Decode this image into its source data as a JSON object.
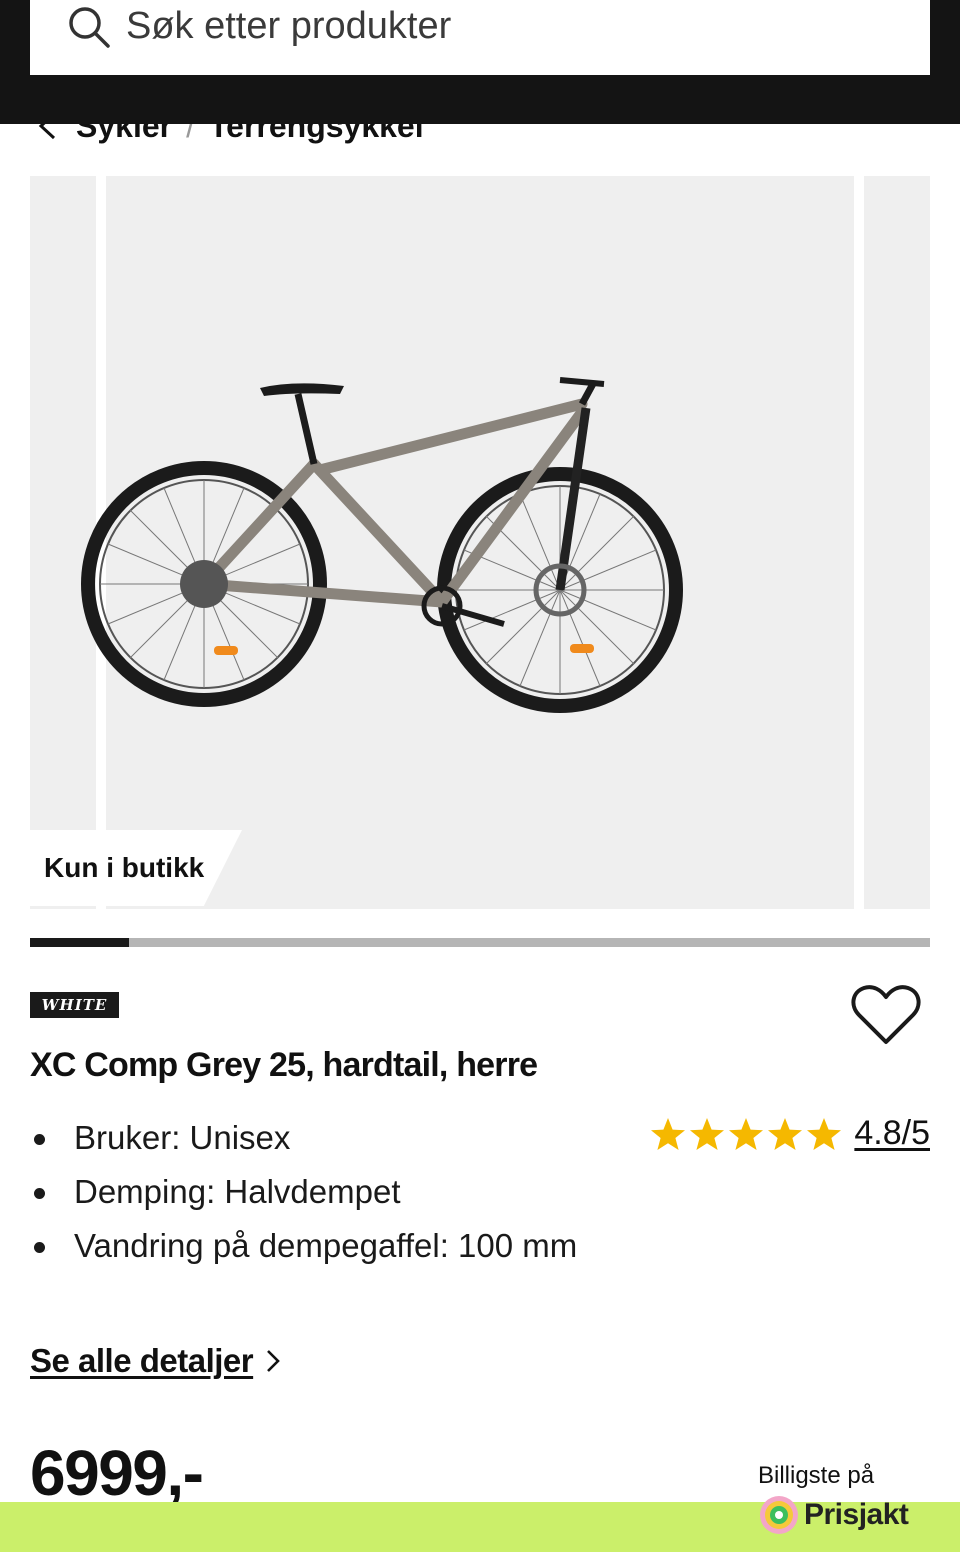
{
  "search": {
    "placeholder": "Søk etter produkter"
  },
  "breadcrumb": {
    "items": [
      "Sykler",
      "Terrengsykkel"
    ],
    "separator": "/"
  },
  "gallery": {
    "badge": "Kun i butikk",
    "progress_fraction": 0.11
  },
  "brand": {
    "logo_text": "WHITE"
  },
  "product": {
    "title": "XC Comp Grey 25, hardtail, herre",
    "specs": [
      "Bruker: Unisex",
      "Demping: Halvdempet",
      "Vandring på dempegaffel: 100 mm"
    ],
    "rating": {
      "stars": 5,
      "value": "4.8/5",
      "star_color": "#f5b800"
    },
    "details_link": "Se alle detaljer",
    "price": "6999,-"
  },
  "prisjakt": {
    "label": "Billigste på",
    "logo_text": "Prisjakt"
  },
  "colors": {
    "header_bg": "#141414",
    "accent_green": "#cbef6a",
    "image_bg": "#efefef"
  },
  "icons": [
    "search-icon",
    "chevron-left-icon",
    "heart-icon",
    "star-icon",
    "chevron-right-icon",
    "prisjakt-logo-icon"
  ]
}
